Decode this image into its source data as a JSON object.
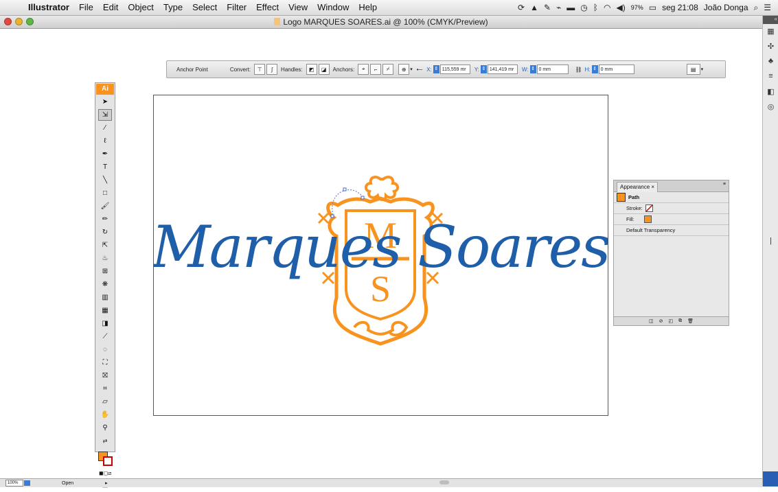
{
  "menubar": {
    "app_name": "Illustrator",
    "items": [
      "File",
      "Edit",
      "Object",
      "Type",
      "Select",
      "Filter",
      "Effect",
      "View",
      "Window",
      "Help"
    ],
    "status": {
      "battery": "97%",
      "clock": "seg 21:08",
      "user": "João Donga"
    }
  },
  "window": {
    "title": "Logo MARQUES SOARES.ai @ 100% (CMYK/Preview)"
  },
  "control_bar": {
    "mode": "Anchor Point",
    "convert_label": "Convert:",
    "handles_label": "Handles:",
    "anchors_label": "Anchors:",
    "x_label": "X:",
    "x_value": "115,559 mr",
    "y_label": "Y:",
    "y_value": "141,419 mr",
    "w_label": "W:",
    "w_value": "0 mm",
    "h_label": "H:",
    "h_value": "0 mm"
  },
  "tools": {
    "logo": "Ai",
    "fill_color": "#f7931e",
    "stroke_color": "#cc0000"
  },
  "artwork": {
    "script_text": "Marques Soares",
    "monogram_top": "M",
    "monogram_bottom": "S",
    "blue_color": "#1f5ea8",
    "orange_color": "#f7931e"
  },
  "appearance_panel": {
    "tab": "Appearance",
    "path_label": "Path",
    "stroke_label": "Stroke:",
    "fill_label": "Fill:",
    "transparency_label": "Default Transparency",
    "fill_color": "#f7931e"
  },
  "status_bar": {
    "zoom": "100%",
    "status": "Open"
  }
}
